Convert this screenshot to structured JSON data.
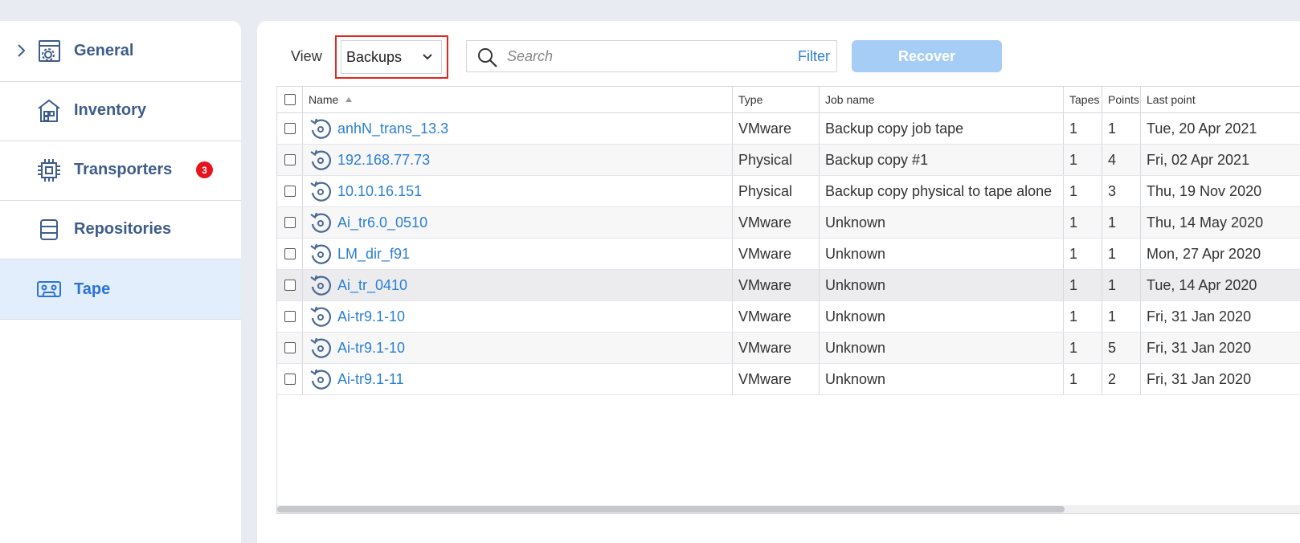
{
  "sidebar": {
    "items": [
      {
        "label": "General",
        "icon": "gear-window-icon"
      },
      {
        "label": "Inventory",
        "icon": "building-icon"
      },
      {
        "label": "Transporters",
        "icon": "chip-icon",
        "badge": "3"
      },
      {
        "label": "Repositories",
        "icon": "database-icon"
      },
      {
        "label": "Tape",
        "icon": "tape-cassette-icon",
        "active": true
      }
    ]
  },
  "toolbar": {
    "view_label": "View",
    "view_value": "Backups",
    "search_placeholder": "Search",
    "filter_label": "Filter",
    "recover_label": "Recover"
  },
  "table": {
    "headers": {
      "name": "Name",
      "type": "Type",
      "job": "Job name",
      "tapes": "Tapes",
      "points": "Points",
      "last": "Last point"
    },
    "rows": [
      {
        "name": "anhN_trans_13.3",
        "type": "VMware",
        "job": "Backup copy job tape",
        "tapes": "1",
        "points": "1",
        "last": "Tue, 20 Apr 2021"
      },
      {
        "name": "192.168.77.73",
        "type": "Physical",
        "job": "Backup copy #1",
        "tapes": "1",
        "points": "4",
        "last": "Fri, 02 Apr 2021"
      },
      {
        "name": "10.10.16.151",
        "type": "Physical",
        "job": "Backup copy physical to tape alone",
        "tapes": "1",
        "points": "3",
        "last": "Thu, 19 Nov 2020"
      },
      {
        "name": "Ai_tr6.0_0510",
        "type": "VMware",
        "job": "Unknown",
        "tapes": "1",
        "points": "1",
        "last": "Thu, 14 May 2020"
      },
      {
        "name": "LM_dir_f91",
        "type": "VMware",
        "job": "Unknown",
        "tapes": "1",
        "points": "1",
        "last": "Mon, 27 Apr 2020"
      },
      {
        "name": "Ai_tr_0410",
        "type": "VMware",
        "job": "Unknown",
        "tapes": "1",
        "points": "1",
        "last": "Tue, 14 Apr 2020"
      },
      {
        "name": "Ai-tr9.1-10",
        "type": "VMware",
        "job": "Unknown",
        "tapes": "1",
        "points": "1",
        "last": "Fri, 31 Jan 2020"
      },
      {
        "name": "Ai-tr9.1-10",
        "type": "VMware",
        "job": "Unknown",
        "tapes": "1",
        "points": "5",
        "last": "Fri, 31 Jan 2020"
      },
      {
        "name": "Ai-tr9.1-11",
        "type": "VMware",
        "job": "Unknown",
        "tapes": "1",
        "points": "2",
        "last": "Fri, 31 Jan 2020"
      }
    ]
  },
  "colors": {
    "accent": "#2b7fd6",
    "nav_text": "#3e5d8a",
    "badge": "#e8141c",
    "recover_disabled": "#a6cdf5"
  }
}
